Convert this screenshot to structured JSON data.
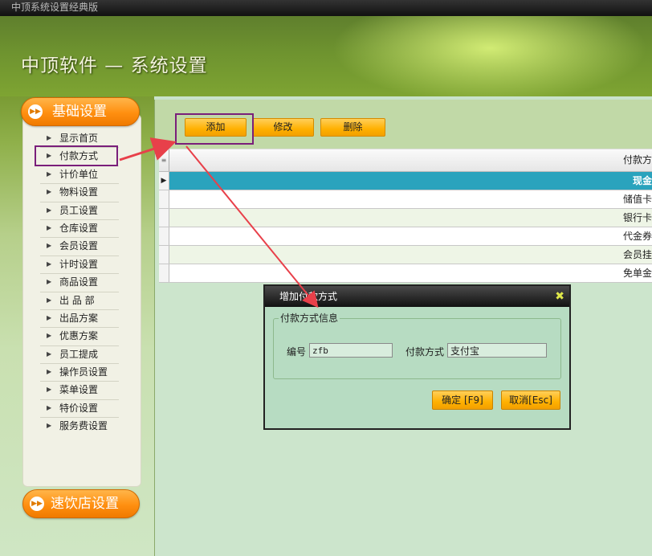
{
  "window": {
    "title": "中顶系统设置经典版"
  },
  "header": {
    "title": "中顶软件 — 系统设置"
  },
  "sidebar": {
    "category_top": "基础设置",
    "category_bottom": "速饮店设置",
    "items": [
      {
        "label": "显示首页"
      },
      {
        "label": "付款方式"
      },
      {
        "label": "计价单位"
      },
      {
        "label": "物料设置"
      },
      {
        "label": "员工设置"
      },
      {
        "label": "仓库设置"
      },
      {
        "label": "会员设置"
      },
      {
        "label": "计时设置"
      },
      {
        "label": "商品设置"
      },
      {
        "label": "出 品 部"
      },
      {
        "label": "出品方案"
      },
      {
        "label": "优惠方案"
      },
      {
        "label": "员工提成"
      },
      {
        "label": "操作员设置"
      },
      {
        "label": "菜单设置"
      },
      {
        "label": "特价设置"
      },
      {
        "label": "服务费设置"
      }
    ]
  },
  "toolbar": {
    "add_label": "添加",
    "edit_label": "修改",
    "delete_label": "删除"
  },
  "table": {
    "header": "付款方",
    "rows": [
      "现金",
      "储值卡",
      "银行卡",
      "代金券",
      "会员挂",
      "免单金"
    ],
    "selected_index": 0
  },
  "dialog": {
    "title": "增加付款方式",
    "group_label": "付款方式信息",
    "code_label": "编号",
    "code_value": "zfb",
    "method_label": "付款方式",
    "method_value": "支付宝",
    "ok_label": "确定 [F9]",
    "cancel_label": "取消[Esc]"
  },
  "colors": {
    "annotation_box": "#7a1f7a",
    "annotation_arrow": "#e8404a",
    "selected_row": "#2aa3bd"
  }
}
